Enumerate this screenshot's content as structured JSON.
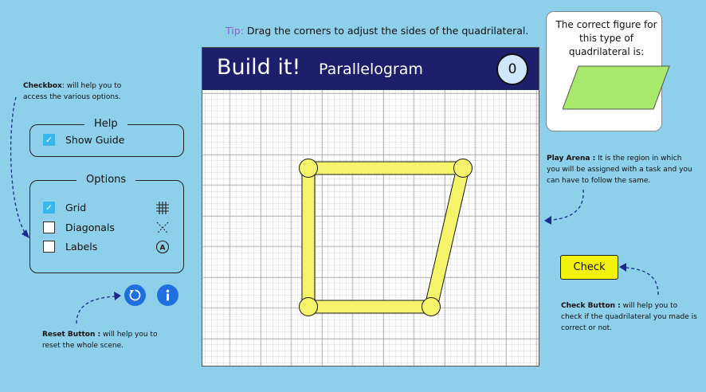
{
  "tip": {
    "label": "Tip:",
    "text": "Drag the corners to adjust the sides of the quadrilateral."
  },
  "header": {
    "title": "Build it!",
    "shape_name": "Parallelogram",
    "score": "0"
  },
  "reference": {
    "text": "The correct figure for this type of quadrilateral is:",
    "fill_color": "#a8e86a"
  },
  "help": {
    "title": "Help",
    "show_guide_label": "Show Guide",
    "show_guide_checked": true
  },
  "options": {
    "title": "Options",
    "items": [
      {
        "label": "Grid",
        "checked": true,
        "icon": "grid-icon"
      },
      {
        "label": "Diagonals",
        "checked": false,
        "icon": "diagonals-icon"
      },
      {
        "label": "Labels",
        "checked": false,
        "icon": "labels-icon"
      }
    ]
  },
  "buttons": {
    "reset_icon": "reset-icon",
    "info_icon": "info-icon",
    "check_label": "Check"
  },
  "annotations": {
    "checkbox_title": "Checkbox",
    "checkbox_text": ": will help you to access the various options.",
    "play_arena_title": "Play Arena :",
    "play_arena_text": " It is the region in which you will be assigned with a task and you can have to follow the same.",
    "check_title": "Check  Button :",
    "check_text": " will help you to check if the quadrilateral you made is correct or not.",
    "reset_title": "Reset Button :",
    "reset_text": " will help you to reset the whole scene."
  },
  "colors": {
    "background": "#8ecfe9",
    "header": "#1c1f6b",
    "shape_fill": "#f4f36a",
    "accent_blue": "#1f6fe0",
    "check_yellow": "#f2f20a"
  }
}
